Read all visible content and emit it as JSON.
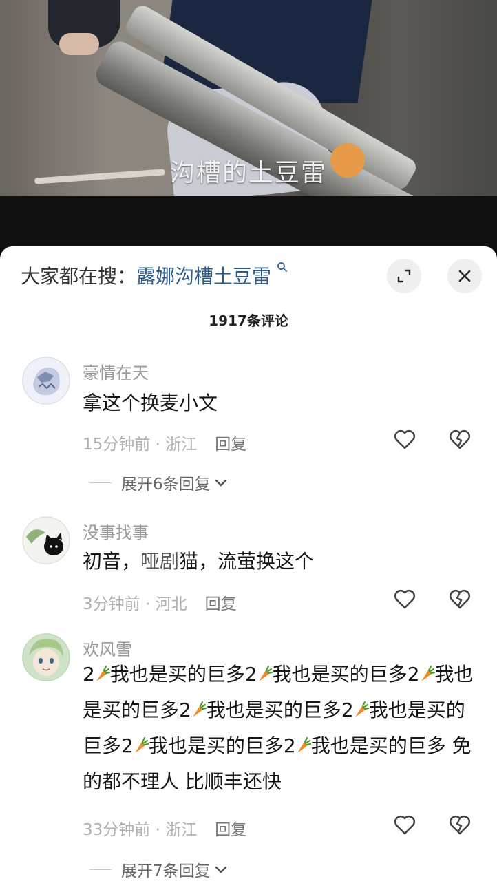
{
  "video": {
    "caption": "沟槽的土豆雷"
  },
  "header": {
    "search_prefix": "大家都在搜：",
    "search_keyword": "露娜沟槽土豆雷",
    "comment_count": "1917条评论"
  },
  "icons": {
    "search": "search-icon",
    "expand": "expand-icon",
    "close": "close-icon",
    "like": "heart-icon",
    "dislike": "broken-heart-icon",
    "chevron": "chevron-down-icon",
    "carrot": "carrot-emoji"
  },
  "colors": {
    "keyword": "#2e5c8a",
    "meta": "#b0b0b0",
    "carrot": "#f08a24"
  },
  "comments": [
    {
      "username": "豪情在天",
      "text": "拿这个换麦小文",
      "time": "15分钟前",
      "separator": " · ",
      "location": "浙江",
      "reply": "回复",
      "expand_replies": "展开6条回复"
    },
    {
      "username": "没事找事",
      "text_before": "初音，",
      "text_watermark": "哑剧",
      "text_after": "猫，流萤换这个",
      "time": "3分钟前",
      "separator": " · ",
      "location": "河北",
      "reply": "回复"
    },
    {
      "username": "欢风雪",
      "segment_num": "2",
      "segment_text": "我也是买的巨多",
      "tail_fragment": "我",
      "tail_text": "也是买的巨多 免的都不理人 比顺丰还快",
      "time": "33分钟前",
      "separator": " · ",
      "location": "浙江",
      "reply": "回复",
      "expand_replies": "展开7条回复"
    }
  ]
}
